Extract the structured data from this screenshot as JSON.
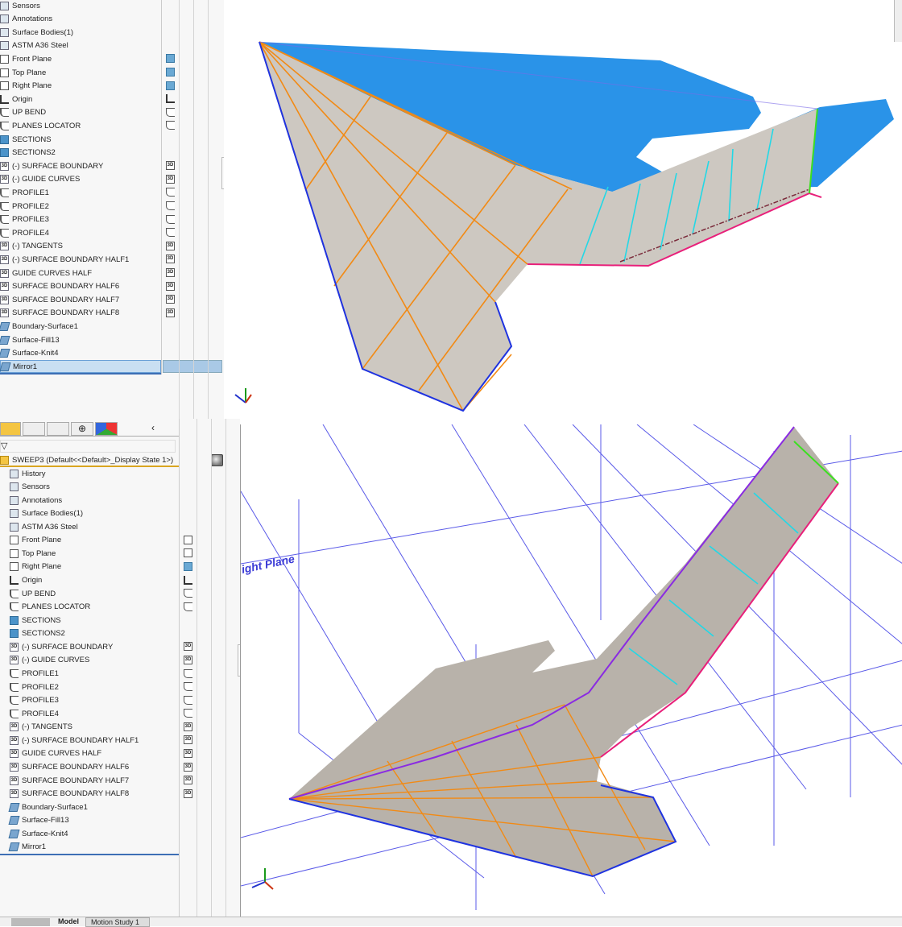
{
  "top_tree": {
    "items": [
      {
        "label": "Sensors",
        "icon": "sensor"
      },
      {
        "label": "Annotations",
        "icon": "annotation"
      },
      {
        "label": "Surface Bodies(1)",
        "icon": "surface-bodies"
      },
      {
        "label": "ASTM A36 Steel",
        "icon": "material"
      },
      {
        "label": "Front Plane",
        "icon": "plane",
        "right": "plane"
      },
      {
        "label": "Top Plane",
        "icon": "plane",
        "right": "plane"
      },
      {
        "label": "Right Plane",
        "icon": "plane",
        "right": "plane"
      },
      {
        "label": "Origin",
        "icon": "origin",
        "right": "origin"
      },
      {
        "label": "UP BEND",
        "icon": "sketch",
        "right": "sketch"
      },
      {
        "label": "PLANES LOCATOR",
        "icon": "sketch",
        "right": "sketch"
      },
      {
        "label": "SECTIONS",
        "icon": "folder"
      },
      {
        "label": "SECTIONS2",
        "icon": "folder"
      },
      {
        "label": "(-) SURFACE BOUNDARY",
        "icon": "3d",
        "right": "3d"
      },
      {
        "label": "(-) GUIDE CURVES",
        "icon": "3d",
        "right": "3d"
      },
      {
        "label": "PROFILE1",
        "icon": "sketch",
        "right": "sketch"
      },
      {
        "label": "PROFILE2",
        "icon": "sketch",
        "right": "sketch"
      },
      {
        "label": "PROFILE3",
        "icon": "sketch",
        "right": "sketch"
      },
      {
        "label": "PROFILE4",
        "icon": "sketch",
        "right": "sketch"
      },
      {
        "label": "(-) TANGENTS",
        "icon": "3d",
        "right": "3d"
      },
      {
        "label": "(-) SURFACE BOUNDARY HALF1",
        "icon": "3d",
        "right": "3d"
      },
      {
        "label": "GUIDE CURVES HALF",
        "icon": "3d",
        "right": "3d"
      },
      {
        "label": "SURFACE BOUNDARY HALF6",
        "icon": "3d",
        "right": "3d"
      },
      {
        "label": "SURFACE BOUNDARY HALF7",
        "icon": "3d",
        "right": "3d"
      },
      {
        "label": "SURFACE BOUNDARY HALF8",
        "icon": "3d",
        "right": "3d"
      },
      {
        "label": "Boundary-Surface1",
        "icon": "feature"
      },
      {
        "label": "Surface-Fill13",
        "icon": "feature"
      },
      {
        "label": "Surface-Knit4",
        "icon": "feature"
      },
      {
        "label": "Mirror1",
        "icon": "feature",
        "selected": true
      }
    ]
  },
  "bottom_tree": {
    "root_label": "SWEEP3  (Default<<Default>_Display State 1>)",
    "items": [
      {
        "label": "History",
        "icon": "history"
      },
      {
        "label": "Sensors",
        "icon": "sensor"
      },
      {
        "label": "Annotations",
        "icon": "annotation"
      },
      {
        "label": "Surface Bodies(1)",
        "icon": "surface-bodies"
      },
      {
        "label": "ASTM A36 Steel",
        "icon": "material"
      },
      {
        "label": "Front Plane",
        "icon": "plane",
        "right": "plane-outline"
      },
      {
        "label": "Top Plane",
        "icon": "plane",
        "right": "plane-outline"
      },
      {
        "label": "Right Plane",
        "icon": "plane",
        "right": "plane"
      },
      {
        "label": "Origin",
        "icon": "origin",
        "right": "origin"
      },
      {
        "label": "UP BEND",
        "icon": "sketch",
        "right": "sketch"
      },
      {
        "label": "PLANES LOCATOR",
        "icon": "sketch",
        "right": "sketch"
      },
      {
        "label": "SECTIONS",
        "icon": "folder"
      },
      {
        "label": "SECTIONS2",
        "icon": "folder"
      },
      {
        "label": "(-) SURFACE BOUNDARY",
        "icon": "3d",
        "right": "3d"
      },
      {
        "label": "(-) GUIDE CURVES",
        "icon": "3d",
        "right": "3d"
      },
      {
        "label": "PROFILE1",
        "icon": "sketch",
        "right": "sketch"
      },
      {
        "label": "PROFILE2",
        "icon": "sketch",
        "right": "sketch"
      },
      {
        "label": "PROFILE3",
        "icon": "sketch",
        "right": "sketch"
      },
      {
        "label": "PROFILE4",
        "icon": "sketch",
        "right": "sketch"
      },
      {
        "label": "(-) TANGENTS",
        "icon": "3d",
        "right": "3d"
      },
      {
        "label": "(-) SURFACE BOUNDARY HALF1",
        "icon": "3d",
        "right": "3d"
      },
      {
        "label": "GUIDE CURVES HALF",
        "icon": "3d",
        "right": "3d"
      },
      {
        "label": "SURFACE BOUNDARY HALF6",
        "icon": "3d",
        "right": "3d"
      },
      {
        "label": "SURFACE BOUNDARY HALF7",
        "icon": "3d",
        "right": "3d"
      },
      {
        "label": "SURFACE BOUNDARY HALF8",
        "icon": "3d",
        "right": "3d"
      },
      {
        "label": "Boundary-Surface1",
        "icon": "feature"
      },
      {
        "label": "Surface-Fill13",
        "icon": "feature"
      },
      {
        "label": "Surface-Knit4",
        "icon": "feature"
      },
      {
        "label": "Mirror1",
        "icon": "feature"
      }
    ]
  },
  "icon_3d_text": "3D",
  "manager_tabs": [
    "feature-manager",
    "property-manager",
    "configuration-manager",
    "dimxpert-manager",
    "display-manager"
  ],
  "viewport_bottom": {
    "plane_label": "ight Plane"
  },
  "triad": {
    "x": "X",
    "y": "Y",
    "z": "Z"
  },
  "bottom_tabs": {
    "model": "Model",
    "motion": "Motion Study 1"
  },
  "colors": {
    "surface": "#c9c4bd",
    "blue_surface": "#2a93e8",
    "orange": "#f28a14",
    "cyan": "#22d8e6",
    "edge_blue": "#1f33e0",
    "magenta": "#e8207a",
    "green": "#3ce020",
    "plane_line": "#5a5ae8",
    "selection": "#c9dff2"
  }
}
